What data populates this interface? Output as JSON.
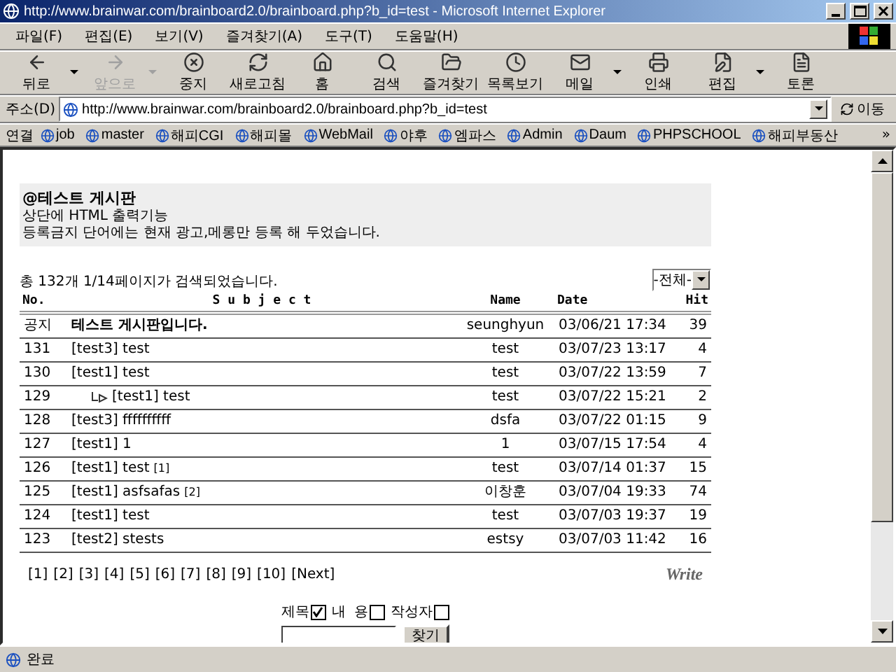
{
  "window": {
    "title": "http://www.brainwar.com/brainboard2.0/brainboard.php?b_id=test - Microsoft Internet Explorer"
  },
  "menu": [
    "파일(F)",
    "편집(E)",
    "보기(V)",
    "즐겨찾기(A)",
    "도구(T)",
    "도움말(H)"
  ],
  "toolbar": [
    {
      "label": "뒤로",
      "disabled": false,
      "dropdown": true
    },
    {
      "label": "앞으로",
      "disabled": true,
      "dropdown": true
    },
    {
      "label": "중지",
      "disabled": false,
      "dropdown": false
    },
    {
      "label": "새로고침",
      "disabled": false,
      "dropdown": false
    },
    {
      "label": "홈",
      "disabled": false,
      "dropdown": false
    },
    {
      "label": "검색",
      "disabled": false,
      "dropdown": false
    },
    {
      "label": "즐겨찾기",
      "disabled": false,
      "dropdown": false
    },
    {
      "label": "목록보기",
      "disabled": false,
      "dropdown": false
    },
    {
      "label": "메일",
      "disabled": false,
      "dropdown": true
    },
    {
      "label": "인쇄",
      "disabled": false,
      "dropdown": false
    },
    {
      "label": "편집",
      "disabled": false,
      "dropdown": true
    },
    {
      "label": "토론",
      "disabled": false,
      "dropdown": false
    }
  ],
  "address": {
    "label": "주소(D)",
    "url": "http://www.brainwar.com/brainboard2.0/brainboard.php?b_id=test",
    "go": "이동"
  },
  "links": {
    "label": "연결",
    "items": [
      "job",
      "master",
      "해피CGI",
      "해피몰",
      "WebMail",
      "야후",
      "엠파스",
      "Admin",
      "Daum",
      "PHPSCHOOL",
      "해피부동산"
    ],
    "more": "»"
  },
  "board": {
    "title": "@테스트 게시판",
    "lines": [
      "상단에 HTML 출력기능",
      "등록금지 단어에는 현재 광고,메롱만 등록 해 두었습니다."
    ],
    "count": "총 132개  1/14페이지가 검색되었습니다.",
    "filter": "-전체-",
    "columns": [
      "No.",
      "S u b j e c t",
      "Name",
      "Date",
      "Hit"
    ],
    "notice": {
      "no": "공지",
      "subject": "테스트 게시판입니다.",
      "name": "seunghyun",
      "date": "03/06/21 17:34",
      "hit": "39"
    },
    "rows": [
      {
        "no": "131",
        "subject": "[test3] test",
        "reply": false,
        "name": "test",
        "date": "03/07/23 13:17",
        "hit": "4"
      },
      {
        "no": "130",
        "subject": "[test1] test",
        "reply": false,
        "name": "test",
        "date": "03/07/22 13:59",
        "hit": "7"
      },
      {
        "no": "129",
        "subject": "[test1] test",
        "reply": true,
        "name": "test",
        "date": "03/07/22 15:21",
        "hit": "2"
      },
      {
        "no": "128",
        "subject": "[test3] ffffffffff",
        "reply": false,
        "name": "dsfa",
        "date": "03/07/22 01:15",
        "hit": "9"
      },
      {
        "no": "127",
        "subject": "[test1] 1",
        "reply": false,
        "name": "1",
        "date": "03/07/15 17:54",
        "hit": "4"
      },
      {
        "no": "126",
        "subject": "[test1] test",
        "comments": "[1]",
        "reply": false,
        "name": "test",
        "date": "03/07/14 01:37",
        "hit": "15"
      },
      {
        "no": "125",
        "subject": "[test1] asfsafas",
        "comments": "[2]",
        "reply": false,
        "name": "이창훈",
        "date": "03/07/04 19:33",
        "hit": "74"
      },
      {
        "no": "124",
        "subject": "[test1] test",
        "reply": false,
        "name": "test",
        "date": "03/07/03 19:37",
        "hit": "19"
      },
      {
        "no": "123",
        "subject": "[test2] stests",
        "reply": false,
        "name": "estsy",
        "date": "03/07/03 11:42",
        "hit": "16"
      }
    ],
    "pages": [
      "[1]",
      "[2]",
      "[3]",
      "[4]",
      "[5]",
      "[6]",
      "[7]",
      "[8]",
      "[9]",
      "[10]"
    ],
    "next": "[Next]",
    "write": "Write",
    "search": {
      "options": [
        {
          "label": "제목",
          "checked": true
        },
        {
          "label": "내  용",
          "checked": false
        },
        {
          "label": "작성자",
          "checked": false
        }
      ],
      "button": "찾기"
    }
  },
  "status": "완료"
}
